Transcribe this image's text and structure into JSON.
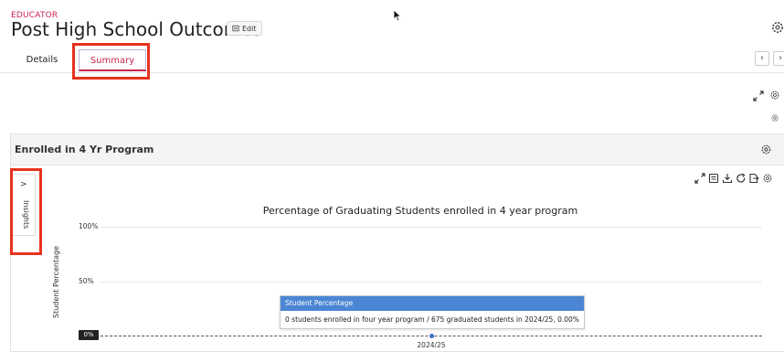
{
  "header": {
    "role_label": "EDUCATOR",
    "title": "Post High School Outcomes",
    "edit_label": "Edit"
  },
  "tabs": [
    {
      "label": "Details"
    },
    {
      "label": "Summary",
      "active": true
    }
  ],
  "widget": {
    "title": "Enrolled in 4 Yr Program",
    "insights_label": "Insights",
    "insights_arrow": ">"
  },
  "chart_data": {
    "type": "line",
    "title": "Percentage of Graduating Students enrolled in 4 year program",
    "xlabel": "",
    "ylabel": "Student Percentage",
    "y_ticks": [
      "100%",
      "50%",
      "0%"
    ],
    "ylim": [
      0,
      100
    ],
    "categories": [
      "2024/25"
    ],
    "series": [
      {
        "name": "Student Percentage",
        "values": [
          0
        ]
      }
    ],
    "tooltip": {
      "header": "Student Percentage",
      "body": "0 students enrolled in four year program / 675 graduated students in 2024/25, 0.00%"
    }
  },
  "colors": {
    "accent": "#c8234f",
    "highlight_box": "#e8321e",
    "series": "#3a6fd0",
    "tooltip_header": "#4a86d4"
  }
}
